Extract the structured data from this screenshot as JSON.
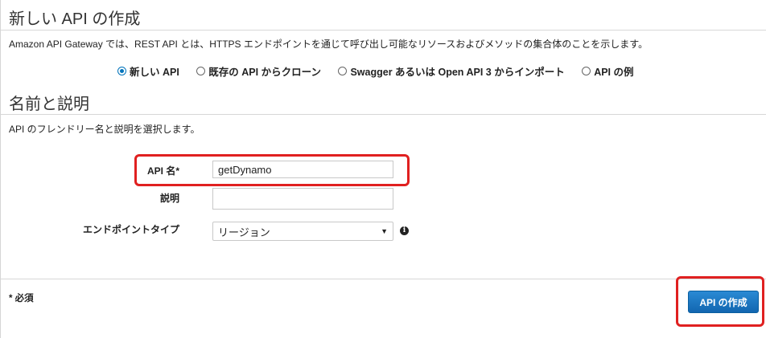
{
  "page": {
    "title": "新しい API の作成",
    "description": "Amazon API Gateway では、REST API とは、HTTPS エンドポイントを通じて呼び出し可能なリソースおよびメソッドの集合体のことを示します。"
  },
  "create_options": [
    {
      "label": "新しい API",
      "selected": true
    },
    {
      "label": "既存の API からクローン",
      "selected": false
    },
    {
      "label": "Swagger あるいは Open API 3 からインポート",
      "selected": false
    },
    {
      "label": "API の例",
      "selected": false
    }
  ],
  "section": {
    "title": "名前と説明",
    "description": "API のフレンドリー名と説明を選択します。"
  },
  "form": {
    "api_name": {
      "label": "API 名*",
      "value": "getDynamo"
    },
    "description": {
      "label": "説明",
      "value": ""
    },
    "endpoint_type": {
      "label": "エンドポイントタイプ",
      "value": "リージョン"
    }
  },
  "footer": {
    "required_note": "* 必須",
    "create_button": "API の作成"
  },
  "colors": {
    "accent": "#0073bb",
    "button": "#1a73c2",
    "highlight": "#e02020"
  },
  "icons": {
    "info": "info-circle-icon",
    "select": "chevron-down-icon"
  }
}
